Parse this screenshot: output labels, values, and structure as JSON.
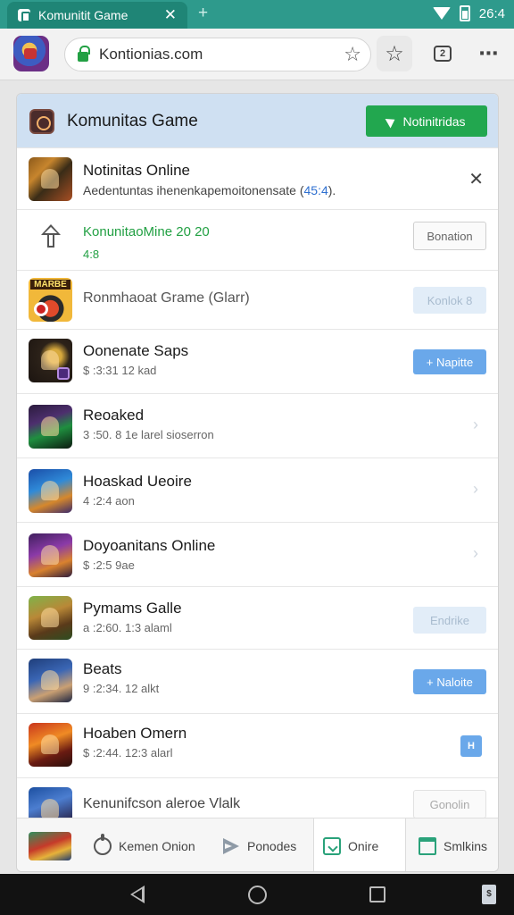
{
  "statusbar": {
    "tab_title": "Komunitit Game",
    "time": "26:4"
  },
  "toolbar": {
    "url": "Kontionias.com"
  },
  "panel": {
    "header_title": "Komunitas Game",
    "header_button": "Notinitridas"
  },
  "rows": [
    {
      "title": "Notinitas Online",
      "sub": "Aedentuntas ihenenkapemoitonensate (",
      "sub_accent": "45:4",
      "sub_tail": ")."
    },
    {
      "title": "KonunitaoMine 20 20",
      "sub": "4:8",
      "button": "Bonation"
    },
    {
      "title": "Ronmhaoat Grame (Glarr)",
      "button": "Konlok 8",
      "thumb_word": "MARBE"
    },
    {
      "title": "Oonenate Saps",
      "sub": "$ :3:31 12 kad",
      "button": "Napitte"
    },
    {
      "title": "Reoaked",
      "sub": "3 :50. 8 1e larel sioserron"
    },
    {
      "title": "Hoaskad Ueoire",
      "sub": "4 :2:4 aon"
    },
    {
      "title": "Doyoanitans Online",
      "sub": "$ :2:5 9ae"
    },
    {
      "title": "Pymams Galle",
      "sub": "a :2:60. 1:3 alaml",
      "button": "Endrike"
    },
    {
      "title": "Beats",
      "sub": "9 :2:34. 12 alkt",
      "button": "Naloite"
    },
    {
      "title": "Hoaben Omern",
      "sub": "$ :2:44. 12:3 alarl"
    },
    {
      "title": "Kenunifcson aleroe Vlalk",
      "button": "Gonolin"
    }
  ],
  "bottomnav": {
    "item1": "Kemen Onion",
    "item2": "Ponodes",
    "item3": "Onire",
    "item4": "Smlkins"
  },
  "icons": [
    "close-icon",
    "plus-icon",
    "wifi-icon",
    "battery-icon",
    "lock-icon",
    "star-icon",
    "tabs-icon",
    "menu-icon",
    "send-icon",
    "update-icon",
    "chevron-right-icon"
  ],
  "colors": {
    "status": "#2e9a8c",
    "accent_green": "#22a74f",
    "accent_blue": "#6aa8ea",
    "header_blue": "#cfe0f2"
  }
}
